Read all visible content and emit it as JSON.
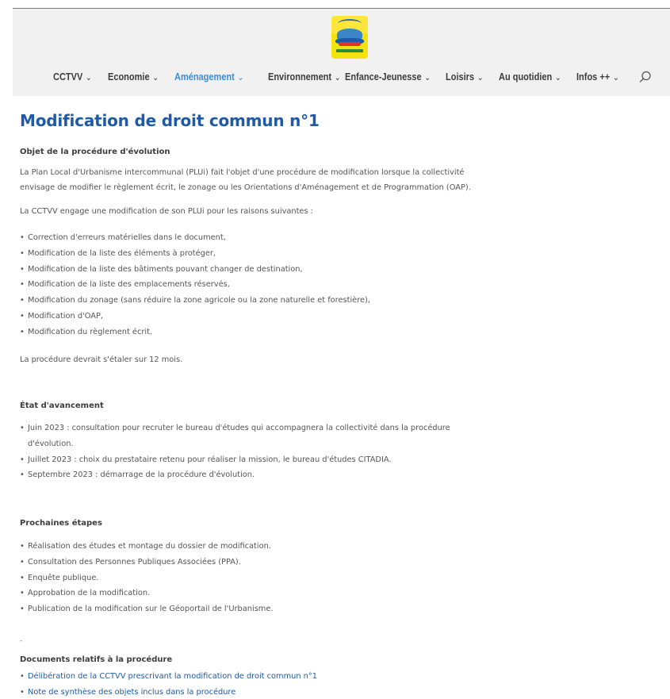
{
  "header": {
    "logo_name": "CCTVV logo",
    "nav": [
      {
        "label": "CCTVV",
        "chevron": "⌄",
        "active": false
      },
      {
        "label": "Economie",
        "chevron": "⌄",
        "active": false
      },
      {
        "label": "Aménagement",
        "chevron": "⌄",
        "active": true
      },
      {
        "label": "Environnement",
        "chevron": "⌄",
        "active": false
      },
      {
        "label": "Enfance-Jeunesse",
        "chevron": "⌄",
        "active": false
      },
      {
        "label": "Loisirs",
        "chevron": "⌄",
        "active": false
      },
      {
        "label": "Au quotidien",
        "chevron": "⌄",
        "active": false
      },
      {
        "label": "Infos ++",
        "chevron": "⌄",
        "active": false
      }
    ],
    "search_icon": "search-icon",
    "colors": {
      "active": "#3a8fd9",
      "nav": "#3d3d3d",
      "header_bg": "#f1f1f1"
    }
  },
  "page": {
    "title": "Modification de droit commun n°1",
    "title_color": "#1f5aa6",
    "section1": {
      "heading": "Objet de la procédure d'évolution",
      "para1_line1": "La Plan Local d'Urbanisme intercommunal (PLUi) fait l'objet d'une procédure de modification lorsque la collectivité",
      "para1_line2": "envisage de modifier le règlement écrit, le zonage ou les Orientations d'Aménagement et de Programmation (OAP).",
      "para2": "La CCTVV engage une modification de son PLUi pour les raisons suivantes :",
      "items": [
        "Correction d'erreurs matérielles dans le document,",
        "Modification de la liste des éléments à protéger,",
        "Modification de la liste des bâtiments pouvant changer de destination,",
        "Modification de la liste des emplacements réservés,",
        "Modification du zonage (sans réduire la zone agricole ou la zone naturelle et forestière),",
        "Modification d'OAP,",
        "Modification du règlement écrit."
      ],
      "para3": "La procédure devrait s'étaler sur 12 mois."
    },
    "section2": {
      "heading": "État d'avancement",
      "item1_line1": "Juin 2023 : consultation pour recruter le bureau d'études qui accompagnera la collectivité dans la procédure",
      "item1_line2": "d'évolution.",
      "item2": "Juillet 2023 : choix du prestataire retenu pour réaliser la mission, le bureau d'études CITADIA.",
      "item3": "Septembre 2023 : démarrage de la procédure d'évolution."
    },
    "section3": {
      "heading": "Prochaines étapes",
      "items": [
        "Réalisation des études et montage du dossier de modification.",
        "Consultation des Personnes Publiques Associées (PPA).",
        "Enquête publique.",
        "Approbation de la modification.",
        "Publication de la modification sur le Géoportail de l'Urbanisme."
      ]
    },
    "separator": "-",
    "section4": {
      "heading": "Documents relatifs à la procédure",
      "links": [
        "Délibération de la CCTVV prescrivant la modification de droit commun n°1",
        "Note de synthèse des objets inclus dans la procédure"
      ]
    }
  }
}
